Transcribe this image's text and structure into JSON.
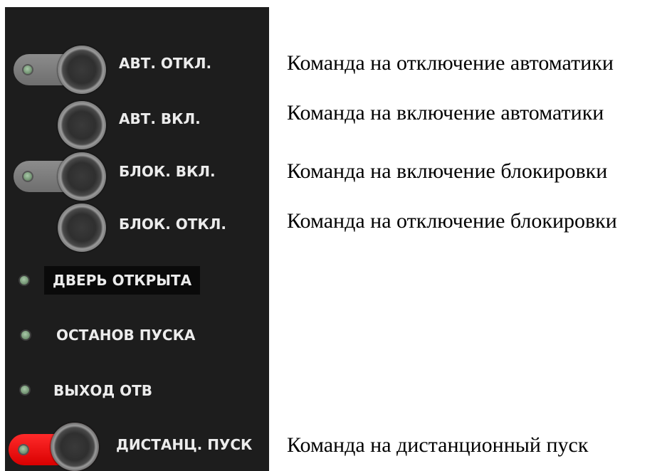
{
  "panel": {
    "controls": [
      {
        "label": "АВТ. ОТКЛ.",
        "description": "Команда на отключение автоматики"
      },
      {
        "label": "АВТ. ВКЛ.",
        "description": "Команда на включение автоматики"
      },
      {
        "label": "БЛОК. ВКЛ.",
        "description": "Команда на включение блокировки"
      },
      {
        "label": "БЛОК. ОТКЛ.",
        "description": "Команда на отключение блокировки"
      },
      {
        "label": "ДВЕРЬ ОТКРЫТА"
      },
      {
        "label": "ОСТАНОВ ПУСКА"
      },
      {
        "label": "ВЫХОД ОТВ"
      },
      {
        "label": "ДИСТАНЦ. ПУСК",
        "description": "Команда на дистанционный пуск"
      }
    ]
  },
  "colors": {
    "panel_background": "#1d1d1d",
    "led_green": "#7a9b7a",
    "toggle_slot_grey": "#7d7d7d",
    "toggle_slot_active_red": "#ff1a1a",
    "label_text": "#ececec"
  }
}
